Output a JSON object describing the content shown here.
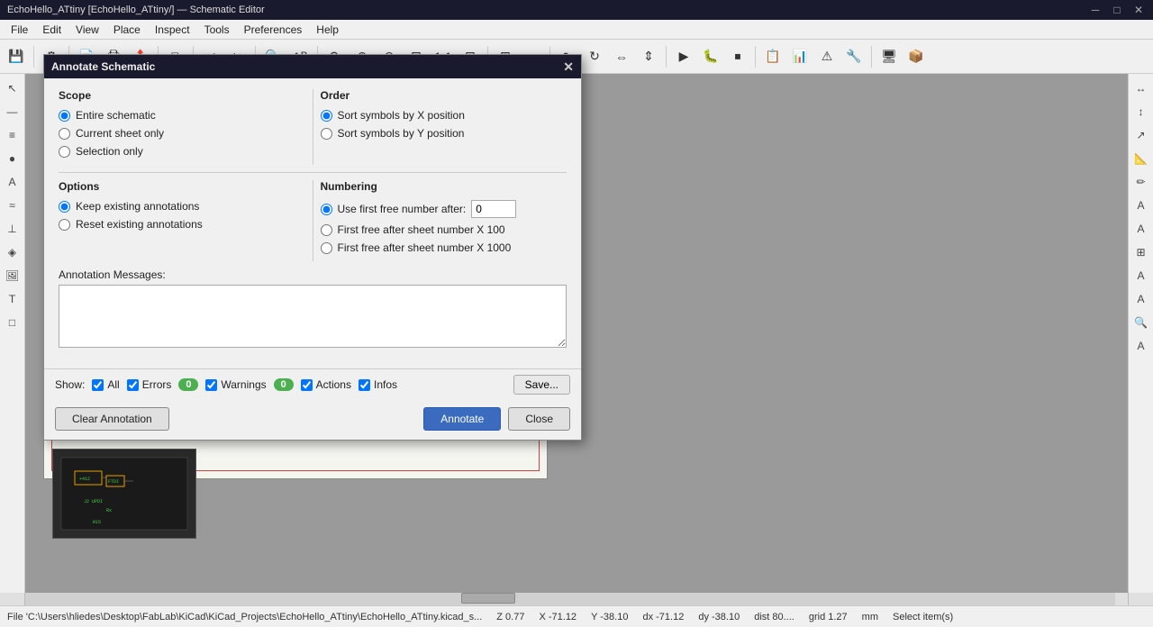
{
  "window": {
    "title": "EchoHello_ATtiny [EchoHello_ATtiny/] — Schematic Editor",
    "close_btn": "✕",
    "minimize_btn": "─",
    "maximize_btn": "□"
  },
  "menu": {
    "items": [
      "File",
      "Edit",
      "View",
      "Place",
      "Inspect",
      "Tools",
      "Preferences",
      "Help"
    ]
  },
  "dialog": {
    "title": "Annotate Schematic",
    "close_btn": "✕",
    "scope": {
      "label": "Scope",
      "options": [
        {
          "id": "entire",
          "label": "Entire schematic",
          "checked": true
        },
        {
          "id": "current",
          "label": "Current sheet only",
          "checked": false
        },
        {
          "id": "selection",
          "label": "Selection only",
          "checked": false
        }
      ]
    },
    "order": {
      "label": "Order",
      "options": [
        {
          "id": "x-pos",
          "label": "Sort symbols by X position",
          "checked": true
        },
        {
          "id": "y-pos",
          "label": "Sort symbols by Y position",
          "checked": false
        }
      ]
    },
    "options": {
      "label": "Options",
      "options": [
        {
          "id": "keep",
          "label": "Keep existing annotations",
          "checked": true
        },
        {
          "id": "reset",
          "label": "Reset existing annotations",
          "checked": false
        }
      ]
    },
    "numbering": {
      "label": "Numbering",
      "options": [
        {
          "id": "first-free",
          "label": "Use first free number after:",
          "checked": true,
          "value": "0"
        },
        {
          "id": "first-100",
          "label": "First free after sheet number X 100",
          "checked": false
        },
        {
          "id": "first-1000",
          "label": "First free after sheet number X 1000",
          "checked": false
        }
      ]
    },
    "annotation_messages": {
      "label": "Annotation Messages:"
    },
    "footer": {
      "show_label": "Show:",
      "checks": [
        {
          "id": "all",
          "label": "All",
          "checked": true
        },
        {
          "id": "errors",
          "label": "Errors",
          "checked": true,
          "badge": null
        },
        {
          "id": "warnings",
          "label": "Warnings",
          "checked": true,
          "badge": "0"
        },
        {
          "id": "actions",
          "label": "Actions",
          "checked": true,
          "badge": null
        },
        {
          "id": "infos",
          "label": "Infos",
          "checked": true,
          "badge": null
        }
      ],
      "errors_badge": "0",
      "warnings_badge": "0",
      "save_label": "Save..."
    },
    "buttons": {
      "clear": "Clear Annotation",
      "annotate": "Annotate",
      "close": "Close"
    }
  },
  "status_bar": {
    "file": "File 'C:\\Users\\hliedes\\Desktop\\FabLab\\KiCad\\KiCad_Projects\\EchoHello_ATtiny\\EchoHello_ATtiny.kicad_s...",
    "zoom": "Z 0.77",
    "x": "X -71.12",
    "y": "Y -38.10",
    "dx": "dx -71.12",
    "dy": "dy -38.10",
    "dist": "dist 80....",
    "grid": "grid 1.27",
    "unit": "mm",
    "mode": "Select item(s)"
  },
  "icons": {
    "save": "💾",
    "undo": "↩",
    "redo": "↪",
    "zoom_in": "+",
    "zoom_out": "−",
    "zoom_fit": "⊞",
    "zoom_reset": "⊡",
    "copy": "⧉",
    "refresh": "⟳",
    "search": "🔍",
    "arrow_up": "↑",
    "arrow_down": "↓",
    "cursor": "↖",
    "rotate": "↻",
    "mirror_h": "⇔",
    "mirror_v": "⇕",
    "star": "★",
    "grid": "⊞",
    "ruler": "📏",
    "eraser": "⌫"
  }
}
